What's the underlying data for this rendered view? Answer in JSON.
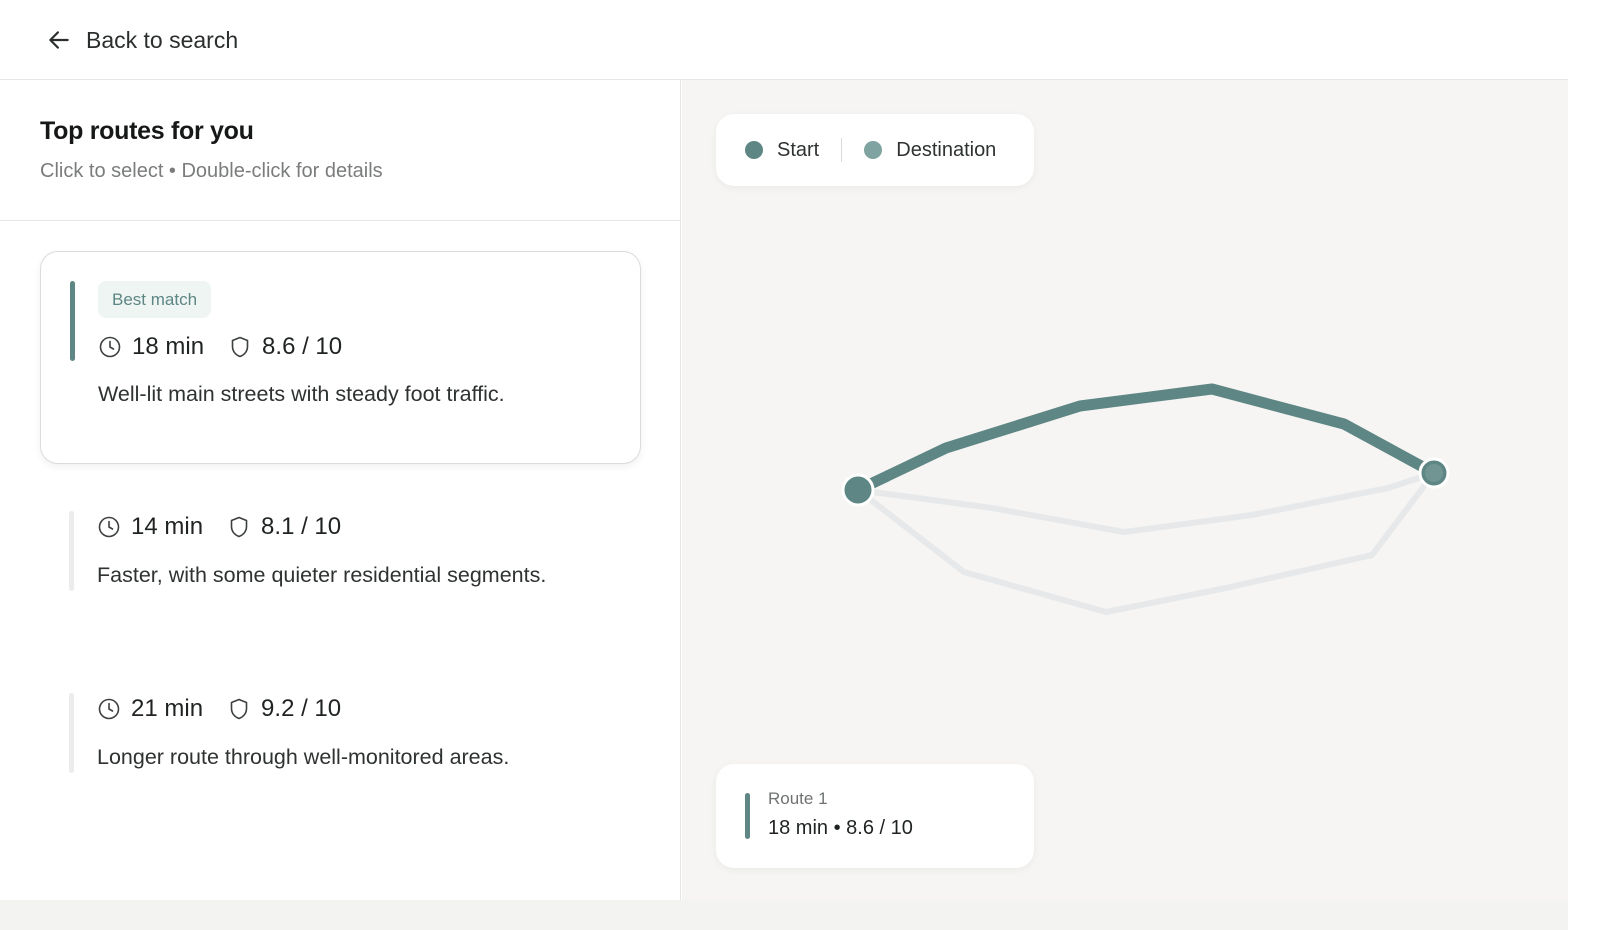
{
  "header": {
    "back_label": "Back to search"
  },
  "sidebar": {
    "title": "Top routes for you",
    "subtitle": "Click to select • Double-click for details"
  },
  "routes": [
    {
      "badge": "Best match",
      "time": "18 min",
      "safety": "8.6 / 10",
      "description": "Well-lit main streets with steady foot traffic.",
      "selected": true
    },
    {
      "time": "14 min",
      "safety": "8.1 / 10",
      "description": "Faster, with some quieter residential segments.",
      "selected": false
    },
    {
      "time": "21 min",
      "safety": "9.2 / 10",
      "description": "Longer route through well-monitored areas.",
      "selected": false
    }
  ],
  "map": {
    "legend": {
      "start_label": "Start",
      "destination_label": "Destination"
    },
    "selected_route": {
      "title": "Route 1",
      "detail": "18 min • 8.6 / 10"
    }
  },
  "colors": {
    "accent": "#5e8684",
    "start_dot": "#5e8684",
    "destination_dot": "#7fa3a1",
    "inactive_route": "#e6e8ea",
    "map_background": "#f6f5f3"
  },
  "icons": {
    "back": "arrow-left-icon",
    "time": "clock-icon",
    "safety": "shield-icon"
  }
}
